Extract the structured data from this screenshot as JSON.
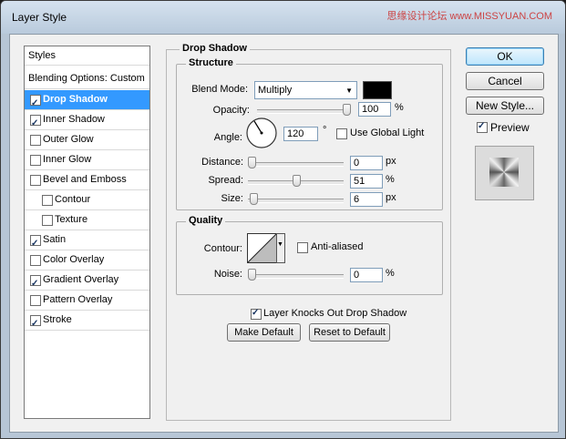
{
  "window": {
    "title": "Layer Style",
    "watermark": "思缘设计论坛  www.MISSYUAN.COM"
  },
  "styles_list": {
    "header": "Styles",
    "blending": "Blending Options: Custom",
    "items": [
      {
        "label": "Drop Shadow",
        "checked": true,
        "selected": true,
        "indent": false
      },
      {
        "label": "Inner Shadow",
        "checked": true,
        "selected": false,
        "indent": false
      },
      {
        "label": "Outer Glow",
        "checked": false,
        "selected": false,
        "indent": false
      },
      {
        "label": "Inner Glow",
        "checked": false,
        "selected": false,
        "indent": false
      },
      {
        "label": "Bevel and Emboss",
        "checked": false,
        "selected": false,
        "indent": false
      },
      {
        "label": "Contour",
        "checked": false,
        "selected": false,
        "indent": true
      },
      {
        "label": "Texture",
        "checked": false,
        "selected": false,
        "indent": true
      },
      {
        "label": "Satin",
        "checked": true,
        "selected": false,
        "indent": false
      },
      {
        "label": "Color Overlay",
        "checked": false,
        "selected": false,
        "indent": false
      },
      {
        "label": "Gradient Overlay",
        "checked": true,
        "selected": false,
        "indent": false
      },
      {
        "label": "Pattern Overlay",
        "checked": false,
        "selected": false,
        "indent": false
      },
      {
        "label": "Stroke",
        "checked": true,
        "selected": false,
        "indent": false
      }
    ]
  },
  "drop_shadow": {
    "title": "Drop Shadow",
    "structure": {
      "title": "Structure",
      "blend_mode_label": "Blend Mode:",
      "blend_mode_value": "Multiply",
      "shadow_color": "#000000",
      "opacity_label": "Opacity:",
      "opacity_value": "100",
      "opacity_fraction": 1.0,
      "percent": "%",
      "angle_label": "Angle:",
      "angle_value": "120",
      "degree": "°",
      "use_global_light": "Use Global Light",
      "use_global_light_checked": false,
      "distance_label": "Distance:",
      "distance_value": "0",
      "distance_fraction": 0.0,
      "spread_label": "Spread:",
      "spread_value": "51",
      "spread_fraction": 0.51,
      "size_label": "Size:",
      "size_value": "6",
      "size_fraction": 0.024,
      "px": "px"
    },
    "quality": {
      "title": "Quality",
      "contour_label": "Contour:",
      "anti_aliased": "Anti-aliased",
      "anti_aliased_checked": false,
      "noise_label": "Noise:",
      "noise_value": "0",
      "noise_fraction": 0.0
    },
    "knockout_label": "Layer Knocks Out Drop Shadow",
    "knockout_checked": true,
    "make_default": "Make Default",
    "reset_default": "Reset to Default"
  },
  "buttons": {
    "ok": "OK",
    "cancel": "Cancel",
    "new_style": "New Style...",
    "preview_label": "Preview",
    "preview_checked": true
  }
}
